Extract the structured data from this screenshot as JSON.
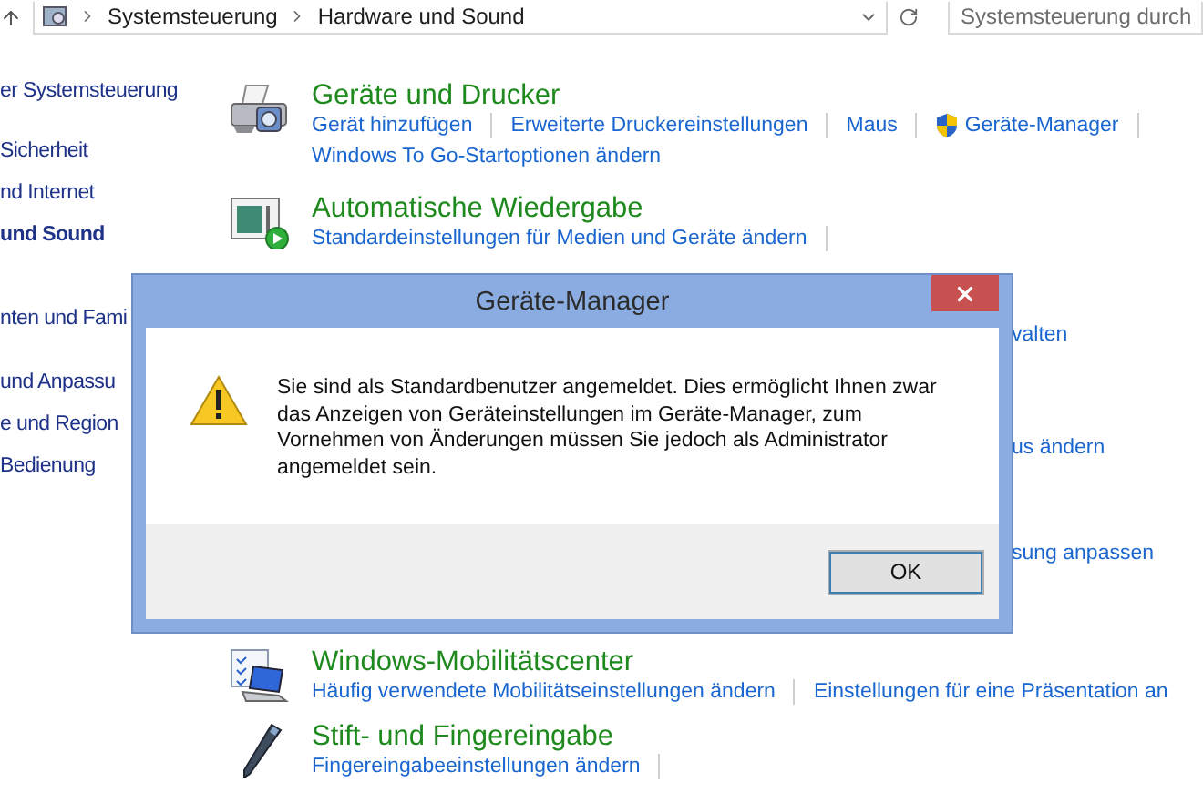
{
  "address_bar": {
    "breadcrumbs": [
      "Systemsteuerung",
      "Hardware und Sound"
    ],
    "search": {
      "placeholder": "Systemsteuerung durch"
    }
  },
  "sidebar": {
    "items": [
      {
        "label": "er Systemsteuerung",
        "selected": false
      },
      {
        "label": "Sicherheit",
        "selected": false
      },
      {
        "label": "nd Internet",
        "selected": false
      },
      {
        "label": "und Sound",
        "selected": true
      },
      {
        "label": "nten und Fami",
        "selected": false
      },
      {
        "label": "und Anpassu",
        "selected": false
      },
      {
        "label": "e und Region",
        "selected": false
      },
      {
        "label": "Bedienung",
        "selected": false
      }
    ]
  },
  "categories_top": [
    {
      "kind": "printer",
      "title": "Geräte und Drucker",
      "links": [
        {
          "label": "Gerät hinzufügen",
          "shield": false
        },
        {
          "label": "Erweiterte Druckereinstellungen",
          "shield": false
        },
        {
          "label": "Maus",
          "shield": false
        },
        {
          "label": "Geräte-Manager",
          "shield": true
        },
        {
          "label": "Windows To Go-Startoptionen ändern",
          "shield": false
        }
      ]
    },
    {
      "kind": "autoplay",
      "title": "Automatische Wiedergabe",
      "links": [
        {
          "label": "Standardeinstellungen für Medien und Geräte ändern",
          "shield": false
        }
      ]
    }
  ],
  "covered_links": [
    "valten",
    "us ändern",
    "sung anpassen"
  ],
  "categories_bottom": [
    {
      "kind": "laptop",
      "title": "Windows-Mobilitätscenter",
      "links": [
        {
          "label": "Häufig verwendete Mobilitätseinstellungen ändern",
          "shield": false
        },
        {
          "label": "Einstellungen für eine Präsentation an",
          "shield": false
        }
      ]
    },
    {
      "kind": "pen",
      "title": "Stift- und Fingereingabe",
      "links": [
        {
          "label": "Fingereingabeeinstellungen ändern",
          "shield": false
        }
      ]
    }
  ],
  "dialog": {
    "title": "Geräte-Manager",
    "message": "Sie sind als Standardbenutzer angemeldet. Dies ermöglicht Ihnen zwar das Anzeigen von Geräteinstellungen im Geräte-Manager, zum Vornehmen von Änderungen müssen Sie jedoch als Administrator angemeldet sein.",
    "buttons": [
      "OK"
    ]
  }
}
